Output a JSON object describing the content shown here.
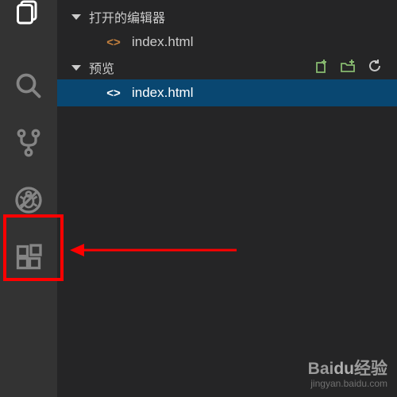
{
  "sections": {
    "openEditors": {
      "title": "打开的编辑器",
      "items": [
        {
          "name": "index.html"
        }
      ]
    },
    "preview": {
      "title": "预览",
      "items": [
        {
          "name": "index.html"
        }
      ]
    }
  },
  "watermark": {
    "brand_a": "Bai",
    "brand_b": "du",
    "brand_c": "经验",
    "url": "jingyan.baidu.com"
  }
}
